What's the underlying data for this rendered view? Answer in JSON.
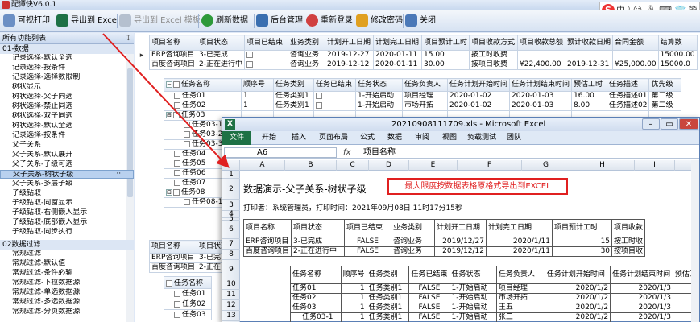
{
  "window": {
    "title": "配谭快V6.0.1"
  },
  "ime": {
    "logo": "S",
    "text": "中 ⁾ ☺ 🎙 ⌨ 👕 簡 ⁝"
  },
  "toolbar": {
    "print": "可视打印",
    "export_excel": "导出到 Excel",
    "export_template": "导出到 Excel 模板",
    "refresh": "刷新数据",
    "admin": "后台管理",
    "relogin": "重新登录",
    "change_pwd": "修改密码",
    "close": "关闭"
  },
  "left_panel": {
    "header": "所有功能列表",
    "pin": "↧",
    "group1": "01-数据",
    "items1": [
      "记录选择-默认全选",
      "记录选择-按条件",
      "记录选择-选择数限制",
      "树状显示",
      "树状选择-父子同选",
      "树状选择-禁止同选",
      "树状选择-双子同选",
      "树状选择-默认全选",
      "记录选择-按条件",
      "父子关系",
      "父子关系-默认展开",
      "父子关系-子级可选",
      "父子关系-树状子级",
      "父子关系-多层子级",
      "子级钻取",
      "子级钻取-同窗显示",
      "子级钻取-右侧嵌入显示",
      "子级钻取-底部嵌入显示",
      "子级钻取-同步执行"
    ],
    "selected_more": "···",
    "group2": "02数据过滤",
    "items2": [
      "常规过滤",
      "常规过滤-默认值",
      "常规过滤-条件必输",
      "常规过滤-下拉数据源",
      "常规过滤-单选数据源",
      "常规过滤-多选数据源",
      "常规过滤-分页数据源"
    ]
  },
  "grid1": {
    "headers": [
      "项目名称",
      "项目状态",
      "项目已结束",
      "业务类别",
      "计划开工日期",
      "计划完工日期",
      "项目预计工时",
      "项目收款方式",
      "项目收款总额",
      "预计收款日期",
      "合同金额",
      "结算数"
    ],
    "rows": [
      {
        "marker": "▸",
        "cells": [
          "ERP咨询项目",
          "3-已完成",
          "",
          "咨询业务",
          "2019-12-27",
          "2020-01-11",
          "15.00",
          "按工时收费",
          "",
          "",
          "",
          "15000.00"
        ]
      },
      {
        "marker": "",
        "cells": [
          "百度咨询项目",
          "2-正在进行中",
          "",
          "咨询业务",
          "2019-12-12",
          "2020-01-11",
          "30.00",
          "按项目收费",
          "¥22,400.00",
          "2019-12-31",
          "¥25,000.00",
          "15000.0"
        ]
      }
    ]
  },
  "grid2": {
    "headers": [
      "任务名称",
      "顺序号",
      "任务类别",
      "任务已结束",
      "任务状态",
      "任务负责人",
      "任务计划开始时间",
      "任务计划结束时间",
      "预估工时",
      "任务描述",
      "优先级"
    ],
    "rows": [
      {
        "indent": 0,
        "exp": "",
        "cells": [
          "任务01",
          "1",
          "任务类别1",
          "",
          "1-开始启动",
          "项目经理",
          "2020-01-02",
          "2020-01-03",
          "16.00",
          "任务描述01",
          "第二级"
        ]
      },
      {
        "indent": 0,
        "exp": "",
        "cells": [
          "任务02",
          "1",
          "任务类别1",
          "",
          "1-开始启动",
          "市场开拓",
          "2020-01-02",
          "2020-01-03",
          "8.00",
          "任务描述02",
          "第二级"
        ]
      },
      {
        "indent": 0,
        "exp": "⊟",
        "cells": [
          "任务03",
          "",
          "",
          "",
          "",
          "",
          "",
          "",
          "",
          "",
          ""
        ]
      },
      {
        "indent": 1,
        "exp": "",
        "cells": [
          "任务03-1",
          "",
          "",
          "",
          "",
          "",
          "",
          "",
          "",
          "",
          ""
        ]
      },
      {
        "indent": 1,
        "exp": "",
        "cells": [
          "任务03-2",
          "",
          "",
          "",
          "",
          "",
          "",
          "",
          "",
          "",
          ""
        ]
      },
      {
        "indent": 1,
        "exp": "",
        "cells": [
          "任务03-3",
          "",
          "",
          "",
          "",
          "",
          "",
          "",
          "",
          "",
          ""
        ]
      },
      {
        "indent": 0,
        "exp": "",
        "cells": [
          "任务04",
          "",
          "",
          "",
          "",
          "",
          "",
          "",
          "",
          "",
          ""
        ]
      },
      {
        "indent": 0,
        "exp": "",
        "cells": [
          "任务05",
          "",
          "",
          "",
          "",
          "",
          "",
          "",
          "",
          "",
          ""
        ]
      },
      {
        "indent": 0,
        "exp": "",
        "cells": [
          "任务06",
          "",
          "",
          "",
          "",
          "",
          "",
          "",
          "",
          "",
          ""
        ]
      },
      {
        "indent": 0,
        "exp": "",
        "cells": [
          "任务07",
          "",
          "",
          "",
          "",
          "",
          "",
          "",
          "",
          "",
          ""
        ]
      },
      {
        "indent": 0,
        "exp": "⊟",
        "cells": [
          "任务08",
          "",
          "",
          "",
          "",
          "",
          "",
          "",
          "",
          "",
          ""
        ]
      },
      {
        "indent": 1,
        "exp": "",
        "cells": [
          "任务08-1",
          "",
          "",
          "",
          "",
          "",
          "",
          "",
          "",
          "",
          ""
        ]
      }
    ]
  },
  "grid3": {
    "header_row": [
      "项目名称",
      "项目状态"
    ],
    "rows": [
      [
        "ERP咨询项目",
        "3-已完"
      ],
      [
        "百度咨询项目",
        "2-正在"
      ]
    ],
    "task_header": "任务名称",
    "tasks": [
      "任务01",
      "任务02",
      "任务03"
    ]
  },
  "excel": {
    "title": "20210908111709.xls - Microsoft Excel",
    "tabs": [
      "文件",
      "开始",
      "插入",
      "页面布局",
      "公式",
      "数据",
      "审阅",
      "视图",
      "负载测试",
      "团队"
    ],
    "namebox": "A6",
    "fx": "fx",
    "formula_value": "项目名称",
    "col_letters": [
      "A",
      "B",
      "C",
      "D",
      "E",
      "F",
      "G",
      "H",
      "I"
    ],
    "row_numbers": [
      "1",
      "2",
      "3",
      "4",
      "5",
      "6",
      "7",
      "8",
      "9",
      "10",
      "11",
      "12",
      "13"
    ],
    "heading": "数据演示-父子关系-树状子级",
    "print_info": "打印者：系统管理员，打印时间：2021年09月08日 11时17分15秒",
    "callout": "最大限度按数据表格原格式导出到EXCEL",
    "table_headers": [
      "项目名称",
      "项目状态",
      "项目已结束",
      "业务类别",
      "计划开工日期",
      "计划完工日期",
      "项目预计工时",
      "项目收款"
    ],
    "table_rows": [
      [
        "ERP咨询项目",
        "3-已完成",
        "FALSE",
        "咨询业务",
        "2019/12/27",
        "2020/1/11",
        "15",
        "按工时收"
      ],
      [
        "百度咨询项目",
        "2-正在进行中",
        "FALSE",
        "咨询业务",
        "2019/12/12",
        "2020/1/11",
        "30",
        "按项目收"
      ]
    ],
    "sub_headers": [
      "任务名称",
      "顺序号",
      "任务类别",
      "任务已结束",
      "任务状态",
      "任务负责人",
      "任务计划开始时间",
      "任务计划结束时间",
      "预估工"
    ],
    "sub_rows": [
      [
        "任务01",
        "1",
        "任务类别1",
        "FALSE",
        "1-开始启动",
        "项目经理",
        "2020/1/2",
        "2020/1/3",
        "1"
      ],
      [
        "任务02",
        "1",
        "任务类别1",
        "FALSE",
        "1-开始启动",
        "市场开拓",
        "2020/1/2",
        "2020/1/3",
        ""
      ],
      [
        "任务03",
        "1",
        "任务类别1",
        "FALSE",
        "1-开始启动",
        "王五",
        "2020/1/2",
        "2020/1/3",
        ""
      ],
      [
        "任务03-1",
        "1",
        "任务类别1",
        "FALSE",
        "1-开始启动",
        "张三",
        "2020/1/2",
        "2020/1/3",
        ""
      ]
    ]
  }
}
